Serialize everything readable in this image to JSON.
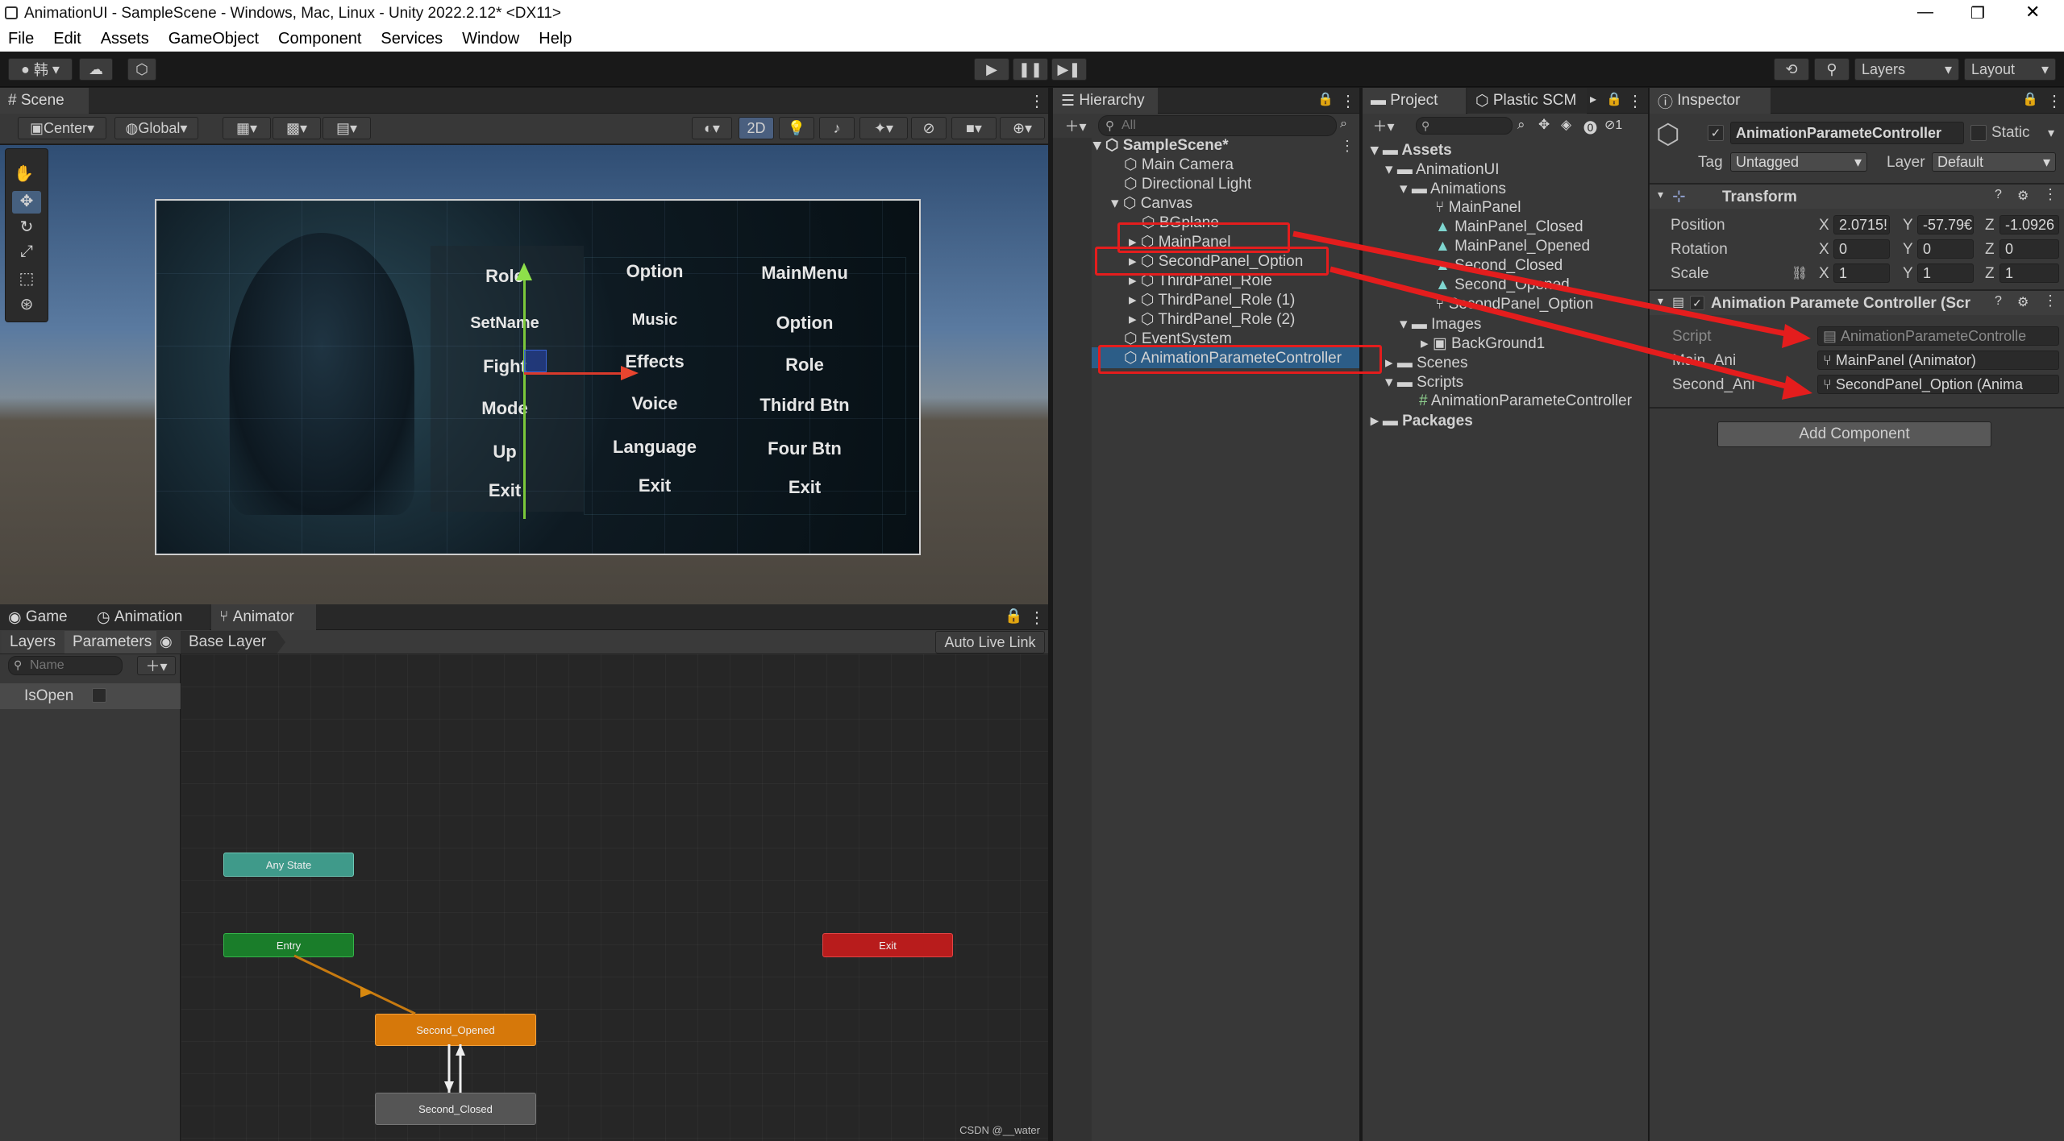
{
  "window": {
    "title": "AnimationUI - SampleScene - Windows, Mac, Linux - Unity 2022.2.12* <DX11>"
  },
  "menu": [
    "File",
    "Edit",
    "Assets",
    "GameObject",
    "Component",
    "Services",
    "Window",
    "Help"
  ],
  "toolbar": {
    "account": "韩",
    "layers": "Layers",
    "layout": "Layout"
  },
  "scene": {
    "tab": "Scene",
    "pivot": "Center",
    "space": "Global",
    "mode2d": "2D",
    "columns": [
      [
        "Role",
        "SetName",
        "Fight",
        "Mode",
        "Up",
        "Exit"
      ],
      [
        "Option",
        "Music",
        "Effects",
        "Voice",
        "Language",
        "Exit"
      ],
      [
        "MainMenu",
        "Option",
        "Role",
        "Thidrd Btn",
        "Four Btn",
        "Exit"
      ]
    ]
  },
  "hierarchy": {
    "tab": "Hierarchy",
    "search_placeholder": "All",
    "scene": "SampleScene*",
    "items": [
      "Main Camera",
      "Directional Light",
      "Canvas",
      "BGplane",
      "MainPanel",
      "SecondPanel_Option",
      "ThirdPanel_Role",
      "ThirdPanel_Role (1)",
      "ThirdPanel_Role (2)",
      "EventSystem",
      "AnimationParameteController"
    ]
  },
  "project": {
    "tabs": [
      "Project",
      "Plastic SCM"
    ],
    "count": "1",
    "tree": [
      "Assets",
      "AnimationUI",
      "Animations",
      "MainPanel",
      "MainPanel_Closed",
      "MainPanel_Opened",
      "Second_Closed",
      "Second_Opened",
      "SecondPanel_Option",
      "Images",
      "BackGround1",
      "Scenes",
      "Scripts",
      "AnimationParameteController",
      "Packages"
    ]
  },
  "inspector": {
    "tab": "Inspector",
    "object_name": "AnimationParameteController",
    "static_label": "Static",
    "tag_label": "Tag",
    "tag_value": "Untagged",
    "layer_label": "Layer",
    "layer_value": "Default",
    "transform_title": "Transform",
    "position_label": "Position",
    "rotation_label": "Rotation",
    "scale_label": "Scale",
    "axis_x": "X",
    "axis_y": "Y",
    "axis_z": "Z",
    "position": [
      "2.0715!",
      "-57.79€",
      "-1.0926"
    ],
    "rotation": [
      "0",
      "0",
      "0"
    ],
    "scale": [
      "1",
      "1",
      "1"
    ],
    "component_title": "Animation Paramete Controller (Scr",
    "script_label": "Script",
    "script_value": "AnimationParameteControlle",
    "main_label": "Main_Ani",
    "main_value": "MainPanel (Animator)",
    "second_label": "Second_Ani",
    "second_value": "SecondPanel_Option (Anima",
    "add_component": "Add Component"
  },
  "bottom": {
    "tabs": [
      "Game",
      "Animation",
      "Animator"
    ],
    "sub_layers": "Layers",
    "sub_params": "Parameters",
    "base_layer": "Base Layer",
    "auto_live": "Auto Live Link",
    "name_placeholder": "Name",
    "param": "IsOpen",
    "nodes": {
      "any": "Any State",
      "entry": "Entry",
      "exit": "Exit",
      "opened": "Second_Opened",
      "closed": "Second_Closed"
    }
  },
  "watermark": "CSDN @__water",
  "colors": {
    "accent_red": "#e41d1d",
    "entry": "#1a7d2a",
    "exit": "#b81c1c",
    "anystate": "#3f9a8a",
    "default_state": "#d6780a"
  }
}
